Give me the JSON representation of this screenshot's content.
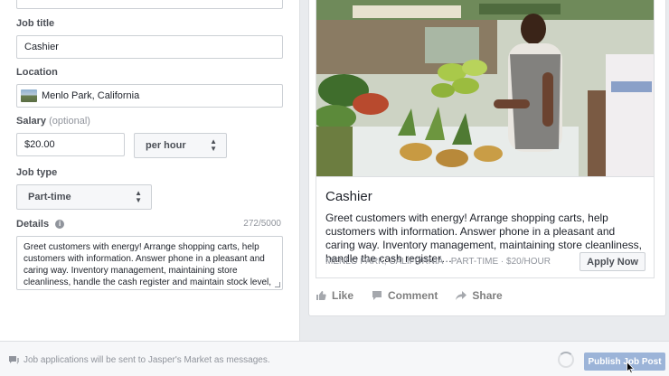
{
  "form": {
    "job_title_label": "Job title",
    "job_title_value": "Cashier",
    "location_label": "Location",
    "location_value": "Menlo Park, California",
    "salary_label": "Salary",
    "salary_optional": "(optional)",
    "salary_value": "$20.00",
    "salary_period": "per hour",
    "job_type_label": "Job type",
    "job_type_value": "Part-time",
    "details_label": "Details",
    "details_counter": "272/5000",
    "details_value": "Greet customers with energy! Arrange shopping carts, help customers with information. Answer phone in a pleasant and caring way. Inventory management, maintaining store cleanliness, handle the cash register and maintain stock level, make orders when we're low in products."
  },
  "preview": {
    "title": "Cashier",
    "description": "Greet customers with energy! Arrange shopping carts, help customers with information. Answer phone in a pleasant and caring way. Inventory management, maintaining store cleanliness, handle the cash register…",
    "meta": "MENLO PARK, CALIFORNIA · PART-TIME · $20/HOUR",
    "apply_label": "Apply Now",
    "actions": {
      "like": "Like",
      "comment": "Comment",
      "share": "Share"
    }
  },
  "footer": {
    "note": "Job applications will be sent to Jasper's Market as messages.",
    "publish_label": "Publish Job Post"
  },
  "icons": [
    "info-icon",
    "caret-icon",
    "like-icon",
    "comment-icon",
    "share-icon",
    "message-icon",
    "spinner-icon",
    "cursor-icon"
  ],
  "colors": {
    "publish_button": "#9cb4d8",
    "page_background": "#e9ebee"
  }
}
